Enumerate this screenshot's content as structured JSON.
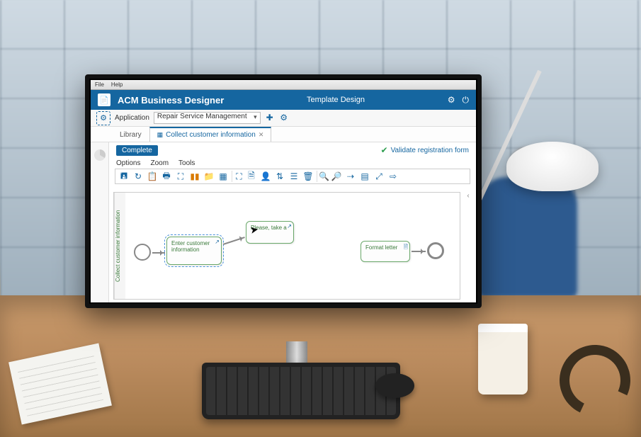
{
  "menubar": {
    "file": "File",
    "help": "Help"
  },
  "titlebar": {
    "app_name": "ACM Business Designer",
    "subtitle": "Template Design"
  },
  "app_row": {
    "label": "Application",
    "selected": "Repair Service Management"
  },
  "tabs": {
    "library": "Library",
    "active": "Collect customer information"
  },
  "status": {
    "badge": "Complete",
    "validate": "Validate registration form"
  },
  "toolbar_menu": {
    "options": "Options",
    "zoom": "Zoom",
    "tools": "Tools"
  },
  "canvas": {
    "lane_label": "Collect customer information",
    "task1": "Enter customer information",
    "task2": "Please, take a",
    "task3": "Format letter"
  }
}
